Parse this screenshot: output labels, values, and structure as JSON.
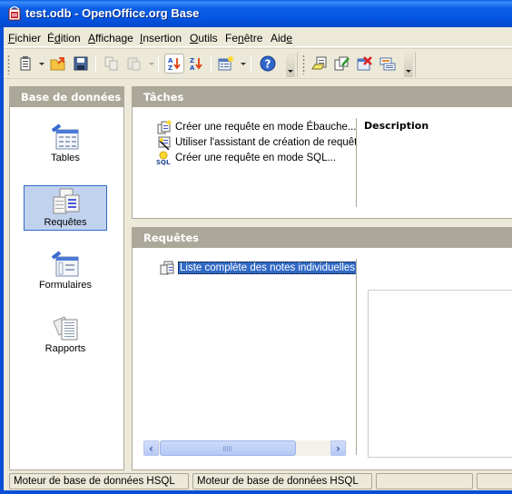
{
  "window": {
    "title": "test.odb - OpenOffice.org Base"
  },
  "menubar": {
    "items": [
      {
        "label": "Fichier",
        "mnemonic": "F"
      },
      {
        "label": "Édition",
        "mnemonic": "d"
      },
      {
        "label": "Affichage",
        "mnemonic": "A"
      },
      {
        "label": "Insertion",
        "mnemonic": "I"
      },
      {
        "label": "Outils",
        "mnemonic": "O"
      },
      {
        "label": "Fenêtre",
        "mnemonic": "n"
      },
      {
        "label": "Aide",
        "mnemonic": "e"
      }
    ]
  },
  "toolbar": {
    "standard": [
      {
        "icon": "new-document-icon",
        "has_dropdown": true
      },
      {
        "icon": "open-folder-icon"
      },
      {
        "icon": "save-icon"
      },
      {
        "icon": "copy-icon",
        "disabled": true
      },
      {
        "icon": "paste-icon",
        "disabled": true,
        "has_dropdown": true
      },
      {
        "icon": "sort-ascending-icon",
        "active": true
      },
      {
        "icon": "sort-descending-icon"
      },
      {
        "icon": "new-form-icon",
        "has_dropdown": true
      },
      {
        "icon": "help-icon"
      }
    ],
    "database": [
      {
        "icon": "open-object-icon"
      },
      {
        "icon": "edit-object-icon"
      },
      {
        "icon": "delete-object-icon"
      },
      {
        "icon": "rename-object-icon"
      }
    ]
  },
  "left_panel": {
    "header": "Base de données",
    "categories": [
      {
        "label": "Tables",
        "icon": "tables-icon",
        "selected": false
      },
      {
        "label": "Requêtes",
        "icon": "queries-icon",
        "selected": true
      },
      {
        "label": "Formulaires",
        "icon": "forms-icon",
        "selected": false
      },
      {
        "label": "Rapports",
        "icon": "reports-icon",
        "selected": false
      }
    ]
  },
  "tasks_panel": {
    "header": "Tâches",
    "tasks": [
      {
        "label": "Créer une requête en mode Ébauche...",
        "icon": "design-query-icon"
      },
      {
        "label": "Utiliser l'assistant de création de requêt",
        "icon": "query-wizard-icon"
      },
      {
        "label": "Créer une requête en mode SQL...",
        "icon": "sql-query-icon"
      }
    ],
    "description_title": "Description"
  },
  "queries_panel": {
    "header": "Requêtes",
    "items": [
      {
        "label": "Liste complète des notes individuelles",
        "selected": true
      }
    ]
  },
  "statusbar": {
    "cells": [
      "Moteur de base de données HSQL",
      "Moteur de base de données HSQL",
      "",
      ""
    ]
  },
  "colors": {
    "titlebar": "#0554e0",
    "panel_header": "#aca899",
    "selection": "#316ac5",
    "selected_category_bg": "#c1d2ee"
  }
}
